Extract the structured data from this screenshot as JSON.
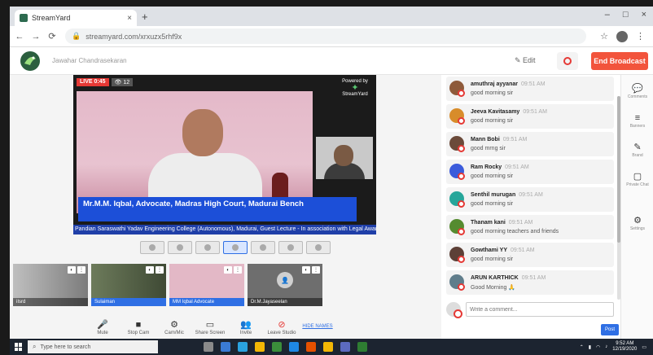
{
  "browser": {
    "tab_title": "StreamYard",
    "tab_close": "×",
    "new_tab": "+",
    "win_controls": [
      "–",
      "□",
      "×"
    ],
    "url": "streamyard.com/xrxuzx5rhf9x",
    "lock": "🔒"
  },
  "header": {
    "breadcrumb": "Jawahar Chandrasekaran",
    "edit_label": "✎ Edit",
    "end_broadcast": "End Broadcast"
  },
  "stage": {
    "live_label": "LIVE 0:45",
    "viewers_label": "👁 12",
    "stream_logo_top": "Powered by",
    "stream_logo_mark": "✦",
    "stream_logo_bottom": "StreamYard",
    "name_line": "Mr.M.M. Iqbal, Advocate, Madras High Court, Madurai Bench",
    "ticker": "Pandian Saraswathi Yadav Engineering College (Autonomous), Madurai, Guest Lecture - In association with Legal Awareness Cell",
    "thumbnails": [
      {
        "label": "iIsrd",
        "selected": false
      },
      {
        "label": "Sulaiman",
        "selected": false
      },
      {
        "label": "MM Iqbal Advocate",
        "selected": true
      },
      {
        "label": "Dr.M.Jayaseelan",
        "selected": false
      }
    ],
    "placeholder_avatar": "👤"
  },
  "toolbar": {
    "items": [
      {
        "icon": "🎤",
        "label": "Mute"
      },
      {
        "icon": "■",
        "label": "Stop Cam"
      },
      {
        "icon": "⚙",
        "label": "Cam/Mic"
      },
      {
        "icon": "▭",
        "label": "Share Screen"
      },
      {
        "icon": "👥",
        "label": "Invite"
      },
      {
        "icon": "⊘",
        "label": "Leave Studio"
      }
    ],
    "link_label": "HIDE NAMES"
  },
  "chat": {
    "messages": [
      {
        "name": "amuthraj ayyanar",
        "time": "09:51 AM",
        "text": "good morning sir",
        "color": "#8e5a3a"
      },
      {
        "name": "Jeeva Kavitasamy",
        "time": "09:51 AM",
        "text": "good morning sir",
        "color": "#d88c2a"
      },
      {
        "name": "Mann Bobi",
        "time": "09:51 AM",
        "text": "good mrng sir",
        "color": "#6b4a3a"
      },
      {
        "name": "Ram Rocky",
        "time": "09:51 AM",
        "text": "good morning sir",
        "color": "#3b5bdb"
      },
      {
        "name": "Senthil murugan",
        "time": "09:51 AM",
        "text": "good morning sir",
        "color": "#26a69a"
      },
      {
        "name": "Thanam kani",
        "time": "09:51 AM",
        "text": "good morning teachers and friends",
        "color": "#558b2f"
      },
      {
        "name": "Gowthami YY",
        "time": "09:51 AM",
        "text": "good morning sir",
        "color": "#5d4037"
      },
      {
        "name": "ARUN KARTHICK",
        "time": "09:51 AM",
        "text": "Good Morning 🙏",
        "color": "#607d8b"
      }
    ],
    "input_placeholder": "Write a comment...",
    "send_label": "Post"
  },
  "rail": {
    "items": [
      {
        "icon": "💬",
        "label": "Comments"
      },
      {
        "icon": "≡",
        "label": "Banners"
      },
      {
        "icon": "✎",
        "label": "Brand"
      },
      {
        "icon": "▢",
        "label": "Private Chat"
      },
      {
        "icon": "⚙",
        "label": "Settings"
      }
    ]
  },
  "taskbar": {
    "search_placeholder": "Type here to search",
    "app_colors": [
      "#8a8a8a",
      "#3a7bd5",
      "#2aa3e0",
      "#f2b705",
      "#3b8e3b",
      "#1e88e5",
      "#e65100",
      "#f2b705",
      "#5c6bc0",
      "#2e7d32"
    ],
    "time": "9:52 AM",
    "date": "12/19/2020"
  }
}
